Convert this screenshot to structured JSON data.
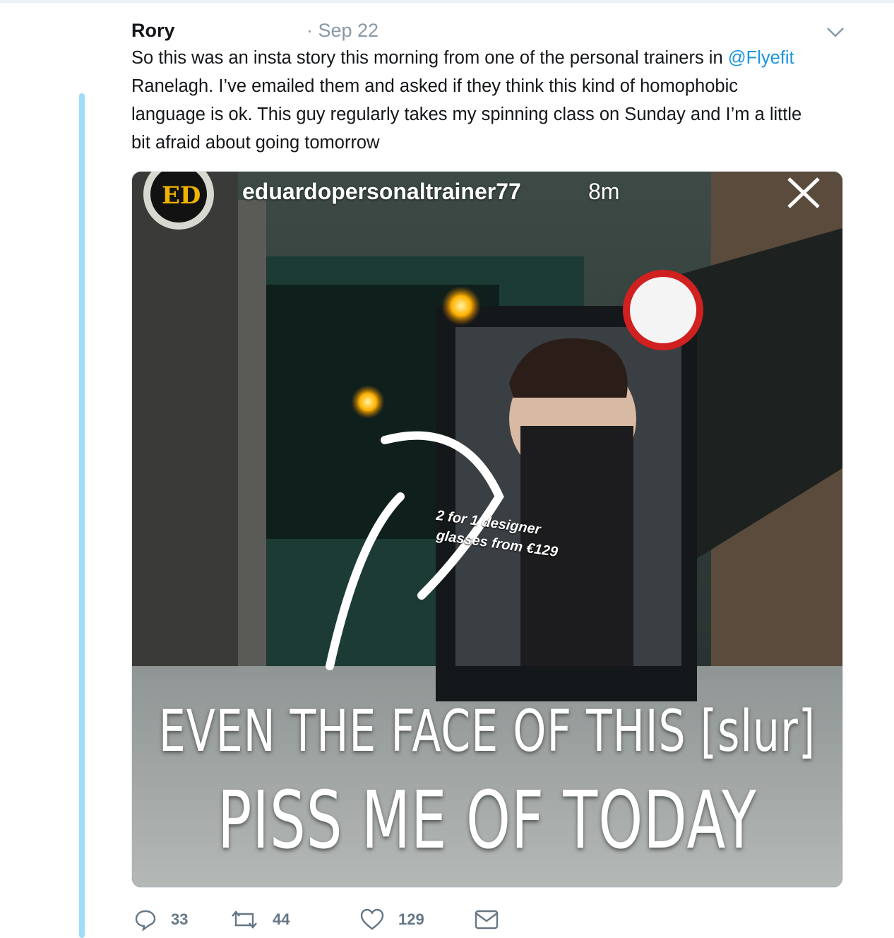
{
  "tweet": {
    "author": "Rory",
    "separator_date": "· Sep 22",
    "text_before": "So this was an insta story this morning from one of the personal trainers in ",
    "mention": "@Flyefit",
    "text_after": " Ranelagh. I’ve emailed them and asked if they think this kind of homophobic language is ok. This guy regularly takes my spinning class on Sunday and I’m a little bit afraid about going tomorrow",
    "menu_icon": "chevron-down-icon"
  },
  "story": {
    "avatar_text": "ED",
    "username": "eduardopersonaltrainer77",
    "time": "8m",
    "close_icon": "close-icon",
    "ad_line1": "2 for 1 designer",
    "ad_line2": "glasses from €129",
    "caption_line1": "EVEN THE FACE OF THIS [slur]",
    "caption_line2": "PISS ME OF TODAY"
  },
  "actions": {
    "reply_count": "33",
    "retweet_count": "44",
    "like_count": "129",
    "icons": [
      "reply-icon",
      "retweet-icon",
      "like-icon",
      "message-icon"
    ]
  },
  "colors": {
    "accent": "#1b95e0",
    "thread_line": "#9fdcfa",
    "muted": "#657786"
  }
}
